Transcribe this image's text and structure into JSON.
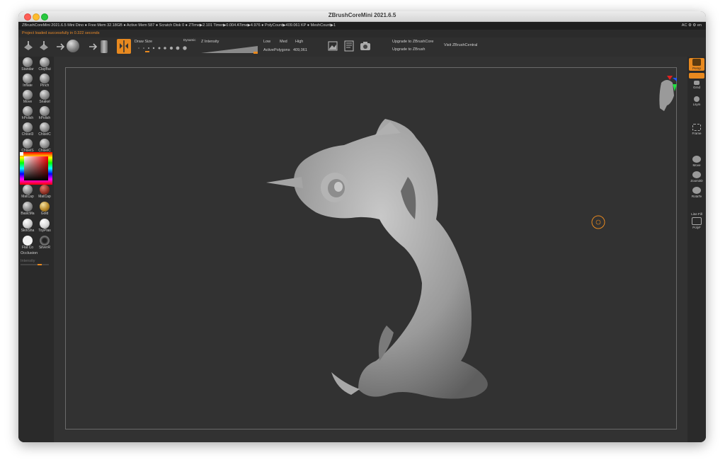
{
  "window": {
    "title": "ZBrushCoreMini 2021.6.5"
  },
  "infobar": {
    "text": "ZBrushCoreMini 2021.6.5 Mini Dino    ● Free Mem 32.18GB ● Active Mem 587 ● Scratch Disk 0 ●  ZTime▶2.101 Timer▶0.004 ATime▶4.976 ● PolyCount▶409.061 KP  ● MeshCount▶1",
    "right": "AC  ⚙  ⚙  en"
  },
  "notice": "Project loaded successfully in 0.322 seconds",
  "toolbar": {
    "draw_size": "Draw Size",
    "dynamic": "Dynamic",
    "z_intensity": "Z Intensity",
    "low": "Low",
    "med": "Med",
    "high": "High",
    "active_polygons": "ActivePolygons",
    "active_polygons_value": "409,061",
    "upgrade_core": "Upgrade to ZBrushCore",
    "upgrade_zbrush": "Upgrade to ZBrush",
    "visit_central": "Visit ZBrushCentral"
  },
  "brushes": [
    {
      "label": "Standar"
    },
    {
      "label": "ClayBui"
    },
    {
      "label": "Inflate"
    },
    {
      "label": "Pinch"
    },
    {
      "label": "Move"
    },
    {
      "label": "Snakel"
    },
    {
      "label": "hPolish"
    },
    {
      "label": "hPolish"
    },
    {
      "label": "Chisel3"
    },
    {
      "label": "ChiselC"
    },
    {
      "label": "ChiselS"
    },
    {
      "label": "ChiselC"
    }
  ],
  "materials": [
    {
      "label": "MatCap"
    },
    {
      "label": "MatCap"
    },
    {
      "label": "BasicMa"
    },
    {
      "label": "Gold"
    },
    {
      "label": "SkinSha"
    },
    {
      "label": "ToyPlas"
    },
    {
      "label": "Flat Co"
    },
    {
      "label": "SilverR"
    }
  ],
  "occlusion": "Occlusion",
  "intensity": "Intensity",
  "rightpanel": [
    {
      "label": "Persp"
    },
    {
      "label": "Grnd"
    },
    {
      "label": "Lsym"
    },
    {
      "label": "Frame"
    },
    {
      "label": "Move"
    },
    {
      "label": "Zoom3D"
    },
    {
      "label": "RotaTe"
    },
    {
      "label": "Line Fill"
    },
    {
      "label": "PolyF"
    }
  ],
  "colors": {
    "accent": "#e8891f",
    "panel": "#2a2a2a",
    "viewport": "#323232"
  }
}
